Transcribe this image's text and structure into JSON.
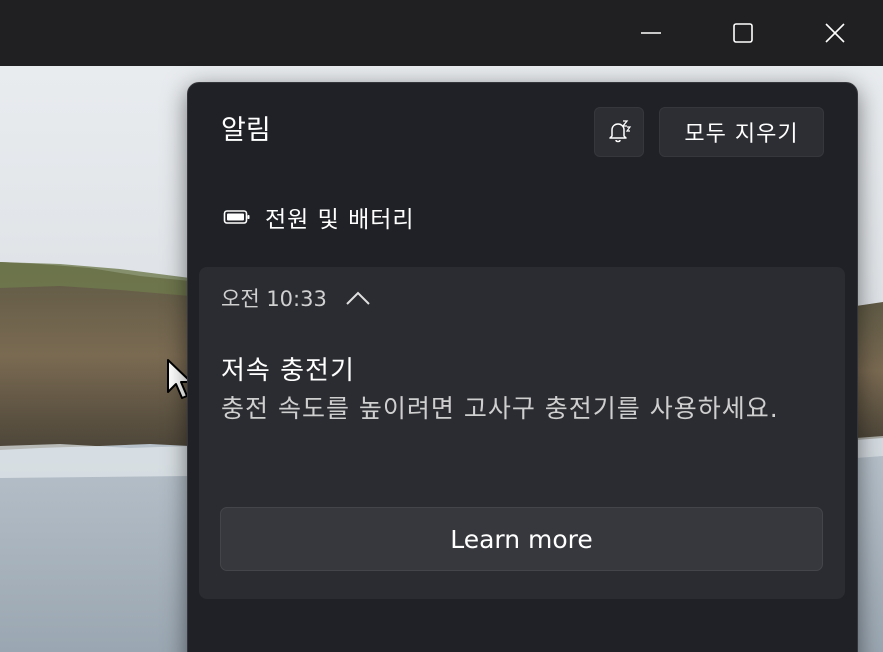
{
  "window": {
    "minimize_icon": "minimize-icon",
    "maximize_icon": "maximize-icon",
    "close_icon": "close-icon"
  },
  "notification_center": {
    "title": "알림",
    "dnd_icon": "bell-snooze-icon",
    "clear_all_label": "모두 지우기",
    "app_group": {
      "icon": "battery-icon",
      "name": "전원 및 배터리"
    },
    "notification": {
      "time": "오전 10:33",
      "collapse_icon": "chevron-up-icon",
      "title": "저속 충전기",
      "body": "충전 속도를 높이려면 고사구 충전기를 사용하세요.",
      "action_label": "Learn more"
    }
  },
  "colors": {
    "panel_bg": "#202126",
    "card_bg": "#2b2c31",
    "button_bg": "#2d2e33",
    "text_primary": "#ffffff",
    "text_secondary": "#cfcfcf"
  }
}
